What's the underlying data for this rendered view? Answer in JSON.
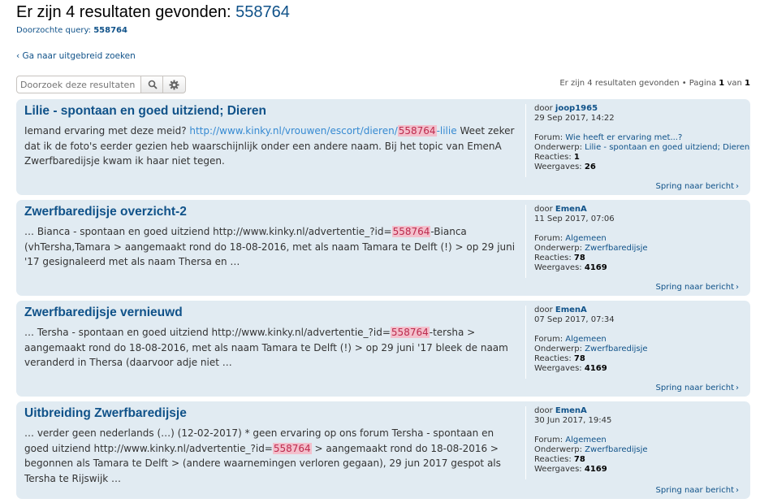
{
  "header": {
    "title_prefix": "Er zijn 4 resultaten gevonden:",
    "title_query": "558764",
    "query_label": "Doorzochte query:",
    "query_value": "558764",
    "advanced_link": "Ga naar uitgebreid zoeken"
  },
  "search": {
    "placeholder": "Doorzoek deze resultaten"
  },
  "pagination": {
    "prefix": "Er zijn 4 resultaten gevonden • Pagina",
    "current": "1",
    "of": "van",
    "total": "1"
  },
  "posts": [
    {
      "title": "Lilie - spontaan en goed uitziend; Dieren",
      "pre": "Iemand ervaring met deze meid? ",
      "link_pre": "http://www.kinky.nl/vrouwen/escort/dieren/",
      "highlight": "558764",
      "link_post": "-lilie",
      "post": " Weet zeker dat ik de foto's eerder gezien heb waarschijnlijk onder een andere naam. Bij het topic van EmenA Zwerfbaredijsje kwam ik haar niet tegen.",
      "by": "door",
      "author": "joop1965",
      "date": "29 Sep 2017, 14:22",
      "forum_label": "Forum:",
      "forum": "Wie heeft er ervaring met...?",
      "topic_label": "Onderwerp:",
      "topic": "Lilie - spontaan en goed uitziend; Dieren",
      "replies_label": "Reacties:",
      "replies": "1",
      "views_label": "Weergaves:",
      "views": "26",
      "jump": "Spring naar bericht"
    },
    {
      "title": "Zwerfbaredijsje overzicht-2",
      "pre": "… Bianca - spontaan en goed uitziend http://www.kinky.nl/advertentie_?id=",
      "highlight": "558764",
      "post": "-Bianca (vhTersha,Tamara > aangemaakt rond do 18-08-2016, met als naam Tamara te Delft (!) > op 29 juni '17 gesignaleerd met als naam Thersa en …",
      "by": "door",
      "author": "EmenA",
      "date": "11 Sep 2017, 07:06",
      "forum_label": "Forum:",
      "forum": "Algemeen",
      "topic_label": "Onderwerp:",
      "topic": "Zwerfbaredijsje",
      "replies_label": "Reacties:",
      "replies": "78",
      "views_label": "Weergaves:",
      "views": "4169",
      "jump": "Spring naar bericht"
    },
    {
      "title": "Zwerfbaredijsje vernieuwd",
      "pre": "… Tersha - spontaan en goed uitziend http://www.kinky.nl/advertentie_?id=",
      "highlight": "558764",
      "post": "-tersha > aangemaakt rond do 18-08-2016, met als naam Tamara te Delft (!) > op 29 juni '17 bleek de naam veranderd in Thersa (daarvoor adje niet …",
      "by": "door",
      "author": "EmenA",
      "date": "07 Sep 2017, 07:34",
      "forum_label": "Forum:",
      "forum": "Algemeen",
      "topic_label": "Onderwerp:",
      "topic": "Zwerfbaredijsje",
      "replies_label": "Reacties:",
      "replies": "78",
      "views_label": "Weergaves:",
      "views": "4169",
      "jump": "Spring naar bericht"
    },
    {
      "title": "Uitbreiding Zwerfbaredijsje",
      "pre": "… verder geen nederlands (…) (12-02-2017) * geen ervaring op ons forum Tersha - spontaan en goed uitziend http://www.kinky.nl/advertentie_?id=",
      "highlight": "558764",
      "post": " > aangemaakt rond do 18-08-2016 > begonnen als Tamara te Delft > (andere waarnemingen verloren gegaan), 29 jun 2017 gespot als Tersha te Rijswijk …",
      "by": "door",
      "author": "EmenA",
      "date": "30 Jun 2017, 19:45",
      "forum_label": "Forum:",
      "forum": "Algemeen",
      "topic_label": "Onderwerp:",
      "topic": "Zwerfbaredijsje",
      "replies_label": "Reacties:",
      "replies": "78",
      "views_label": "Weergaves:",
      "views": "4169",
      "jump": "Spring naar bericht"
    }
  ]
}
